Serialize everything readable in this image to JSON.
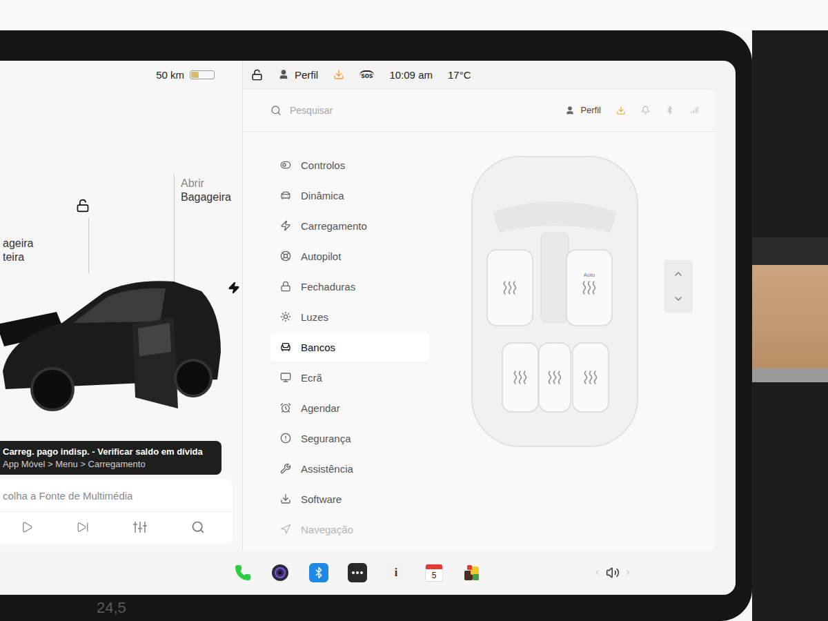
{
  "status_bar": {
    "range": "50 km",
    "battery_level": 0.35,
    "locked": false,
    "profile": "Perfil",
    "sos": "sos",
    "time": "10:09 am",
    "temperature": "17°C"
  },
  "car_view": {
    "frunk_label": [
      "ageira",
      "teira"
    ],
    "trunk_label": [
      "Abrir",
      "Bagageira"
    ],
    "locked": false
  },
  "notification": {
    "title": "Carreg. pago indisp. - Verificar saldo em dívida",
    "subtitle": "App Móvel > Menu > Carregamento"
  },
  "media": {
    "source_prompt": "colha a Fonte de Multimédia"
  },
  "settings": {
    "search_placeholder": "Pesquisar",
    "profile": "Perfil",
    "menu": [
      {
        "label": "Controlos",
        "selected": false,
        "dimmed": false
      },
      {
        "label": "Dinâmica",
        "selected": false,
        "dimmed": false
      },
      {
        "label": "Carregamento",
        "selected": false,
        "dimmed": false
      },
      {
        "label": "Autopilot",
        "selected": false,
        "dimmed": false
      },
      {
        "label": "Fechaduras",
        "selected": false,
        "dimmed": false
      },
      {
        "label": "Luzes",
        "selected": false,
        "dimmed": false
      },
      {
        "label": "Bancos",
        "selected": true,
        "dimmed": false
      },
      {
        "label": "Ecrã",
        "selected": false,
        "dimmed": false
      },
      {
        "label": "Agendar",
        "selected": false,
        "dimmed": false
      },
      {
        "label": "Segurança",
        "selected": false,
        "dimmed": false
      },
      {
        "label": "Assistência",
        "selected": false,
        "dimmed": false
      },
      {
        "label": "Software",
        "selected": false,
        "dimmed": false
      },
      {
        "label": "Navegação",
        "selected": false,
        "dimmed": true
      }
    ]
  },
  "seats": {
    "auto_label": "Auto",
    "items": [
      {
        "auto": false,
        "heater_on": false
      },
      {
        "auto": true,
        "heater_on": false
      },
      {
        "auto": false,
        "heater_on": false
      },
      {
        "auto": false,
        "heater_on": false
      },
      {
        "auto": false,
        "heater_on": false
      }
    ]
  },
  "dock": {
    "info_glyph": "i",
    "calendar_day": "5"
  },
  "footer": {
    "odometer": "24,5"
  }
}
